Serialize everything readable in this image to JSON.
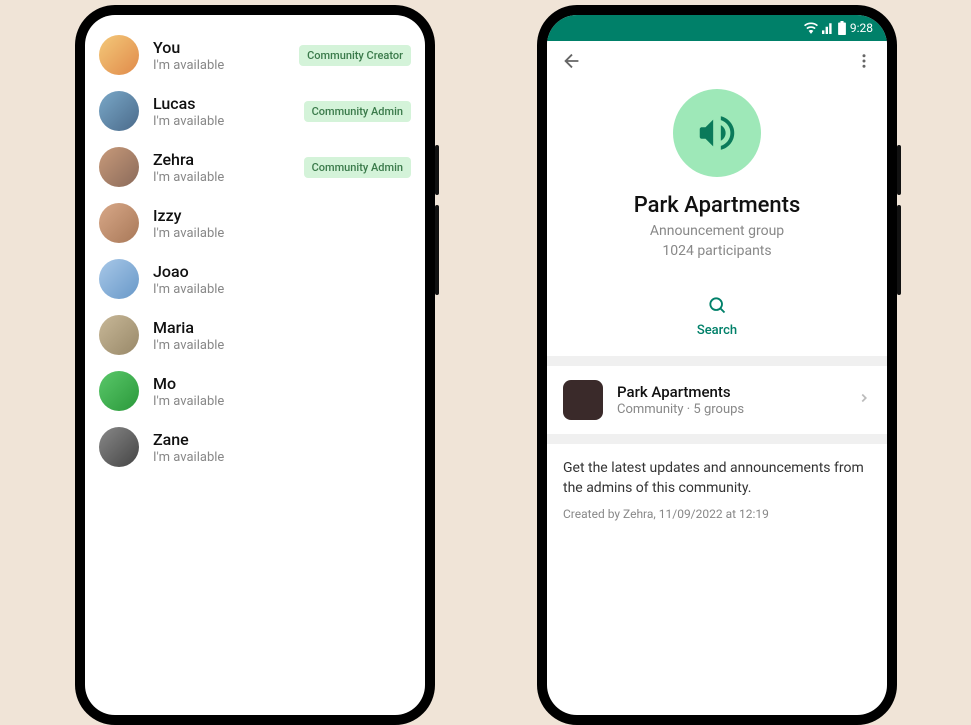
{
  "left": {
    "members": [
      {
        "name": "You",
        "status": "I'm available",
        "badge": "Community Creator",
        "bg": "linear-gradient(135deg,#f4c97a,#e08a4a)"
      },
      {
        "name": "Lucas",
        "status": "I'm available",
        "badge": "Community Admin",
        "bg": "linear-gradient(135deg,#7aa8c8,#4a6a8a)"
      },
      {
        "name": "Zehra",
        "status": "I'm available",
        "badge": "Community Admin",
        "bg": "linear-gradient(135deg,#c89a7a,#8a6a5a)"
      },
      {
        "name": "Izzy",
        "status": "I'm available",
        "badge": null,
        "bg": "linear-gradient(135deg,#d8a888,#a87858)"
      },
      {
        "name": "Joao",
        "status": "I'm available",
        "badge": null,
        "bg": "linear-gradient(135deg,#a8c8e8,#6898c8)"
      },
      {
        "name": "Maria",
        "status": "I'm available",
        "badge": null,
        "bg": "linear-gradient(135deg,#c8b898,#988868)"
      },
      {
        "name": "Mo",
        "status": "I'm available",
        "badge": null,
        "bg": "linear-gradient(135deg,#5ac86a,#2a983a)"
      },
      {
        "name": "Zane",
        "status": "I'm available",
        "badge": null,
        "bg": "linear-gradient(135deg,#888,#444)"
      }
    ]
  },
  "right": {
    "status_time": "9:28",
    "group": {
      "title": "Park Apartments",
      "subtitle1": "Announcement group",
      "subtitle2": "1024 participants"
    },
    "search_label": "Search",
    "community": {
      "name": "Park Apartments",
      "subtitle": "Community · 5 groups"
    },
    "description": "Get the latest updates and announcements from the admins of this community.",
    "created": "Created by Zehra, 11/09/2022 at 12:19"
  }
}
